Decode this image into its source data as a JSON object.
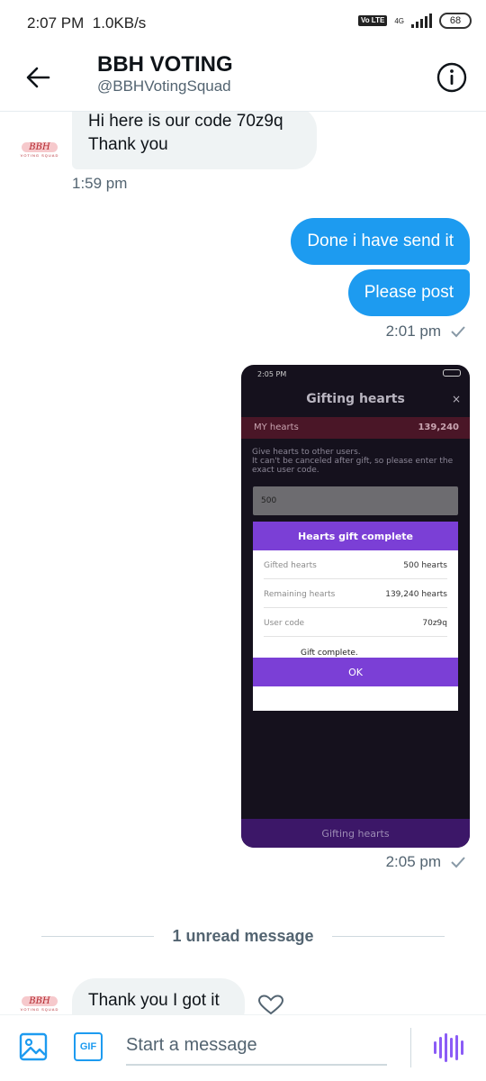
{
  "status_bar": {
    "time": "2:07 PM",
    "speed": "1.0KB/s",
    "network": "4G",
    "volte": "Vo LTE",
    "battery": "68"
  },
  "header": {
    "title": "BBH VOTING",
    "handle": "@BBHVotingSquad"
  },
  "avatar": {
    "logo_text": "BBH",
    "logo_sub": "VOTING SQUAD"
  },
  "messages": [
    {
      "direction": "in",
      "lines": [
        "Hi here is our code 70z9q",
        "Thank you"
      ],
      "time": "1:59 pm"
    },
    {
      "direction": "out",
      "text": "Done i have send it"
    },
    {
      "direction": "out",
      "text": "Please post",
      "time": "2:01 pm"
    },
    {
      "direction": "out",
      "type": "image",
      "time": "2:05 pm"
    },
    {
      "direction": "in",
      "text": "Thank you I got it"
    }
  ],
  "screenshot": {
    "time": "2:05 PM",
    "title": "Gifting hearts",
    "close": "×",
    "my_hearts_label": "MY hearts",
    "my_hearts_value": "139,240",
    "description": "Give hearts to other users.\n It can't be canceled after gift, so please enter the exact user code.",
    "input_value": "500",
    "modal_title": "Hearts gift complete",
    "rows": [
      {
        "label": "Gifted hearts",
        "value": "500 hearts"
      },
      {
        "label": "Remaining hearts",
        "value": "139,240 hearts"
      },
      {
        "label": "User code",
        "value": "70z9q"
      }
    ],
    "message": "Gift complete.\nPlease check the hearts.",
    "ok": "OK",
    "bottom_button": "Gifting hearts"
  },
  "unread_divider": "1 unread message",
  "composer": {
    "gif_label": "GIF",
    "placeholder": "Start a message"
  },
  "colors": {
    "accent": "#1d9bf0",
    "bubble_in": "#eff3f4",
    "voice": "#8b5cf6",
    "modal_purple": "#7b3fd6"
  }
}
